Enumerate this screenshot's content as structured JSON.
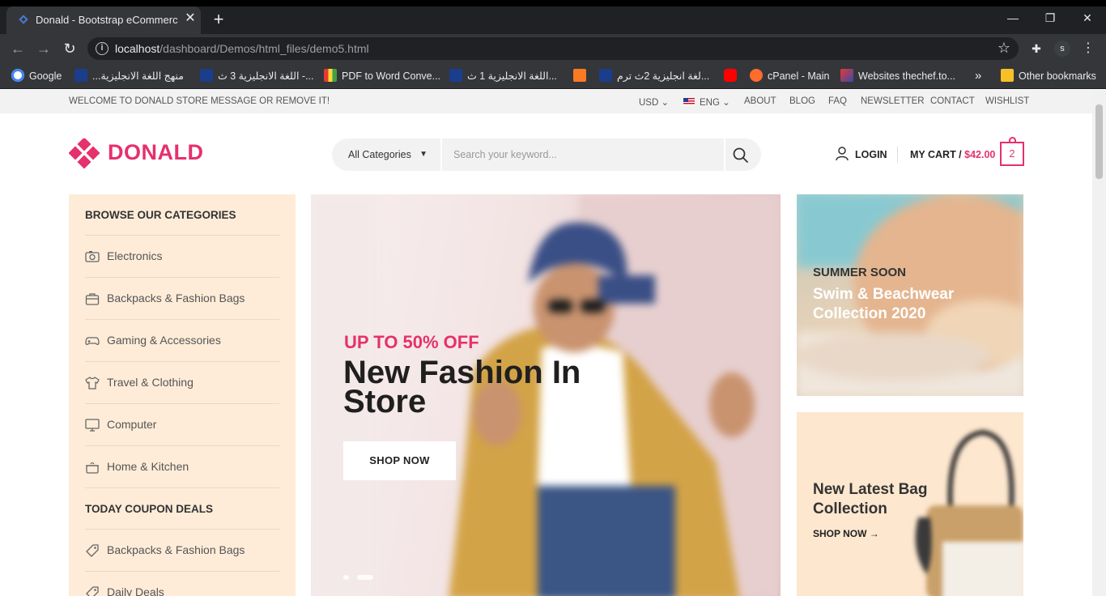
{
  "browser": {
    "tab_title": "Donald - Bootstrap eCommerce T",
    "tab_close": "✕",
    "new_tab": "+",
    "window_controls": [
      "—",
      "❐",
      "✕"
    ],
    "url_host": "localhost",
    "url_path": "/dashboard/Demos/html_files/demo5.html",
    "profile_initial": "s",
    "bookmarks": [
      {
        "label": "Google",
        "icon": "google-icon",
        "color": "#4285f4"
      },
      {
        "label": "...منهج اللغة الانجليزية",
        "icon": "site-icon",
        "color": "#1a3e8c"
      },
      {
        "label": "اللغة الانجليزية 3 ث -...",
        "icon": "site-icon",
        "color": "#1a3e8c"
      },
      {
        "label": "PDF to Word Conve...",
        "icon": "pdf-icon",
        "color": "#7b3fe4"
      },
      {
        "label": "اللغة الانجليزية 1 ث...",
        "icon": "site-icon",
        "color": "#1a3e8c"
      },
      {
        "label": "",
        "icon": "xampp-icon",
        "color": "#fb7a24"
      },
      {
        "label": "لغة انجليزية 2ث ترم...",
        "icon": "site-icon",
        "color": "#1a3e8c"
      },
      {
        "label": "",
        "icon": "youtube-icon",
        "color": "#ff0000"
      },
      {
        "label": "cPanel - Main",
        "icon": "cpanel-icon",
        "color": "#ff6c2c"
      },
      {
        "label": "Websites thechef.to...",
        "icon": "site-icon",
        "color": "#7b1fa2"
      }
    ],
    "bookmarks_more": "»",
    "other_bookmarks": "Other bookmarks"
  },
  "topbar": {
    "welcome": "WELCOME TO DONALD STORE MESSAGE OR REMOVE IT!",
    "currency": "USD",
    "language": "ENG",
    "links": [
      "ABOUT",
      "BLOG",
      "FAQ",
      "NEWSLETTER",
      "CONTACT",
      "WISHLIST"
    ]
  },
  "header": {
    "brand": "DONALD",
    "brand_color": "#e5316c",
    "category_select": "All Categories",
    "search_placeholder": "Search your keyword...",
    "login": "LOGIN",
    "cart_label": "MY CART /",
    "cart_total": "$42.00",
    "cart_count": "2"
  },
  "sidebar": {
    "browse_heading": "BROWSE OUR CATEGORIES",
    "categories": [
      {
        "label": "Electronics",
        "icon": "camera-icon"
      },
      {
        "label": "Backpacks & Fashion Bags",
        "icon": "bag-icon"
      },
      {
        "label": "Gaming & Accessories",
        "icon": "gamepad-icon"
      },
      {
        "label": "Travel & Clothing",
        "icon": "shirt-icon"
      },
      {
        "label": "Computer",
        "icon": "monitor-icon"
      },
      {
        "label": "Home & Kitchen",
        "icon": "pot-icon"
      }
    ],
    "deals_heading": "TODAY COUPON DEALS",
    "deals": [
      {
        "label": "Backpacks & Fashion Bags",
        "icon": "tag-icon"
      },
      {
        "label": "Daily Deals",
        "icon": "tag-icon"
      }
    ]
  },
  "hero": {
    "promo": "UP TO 50% OFF",
    "headline": "New Fashion In Store",
    "cta": "SHOP NOW",
    "slide_count": 2,
    "active_slide": 2
  },
  "banners": [
    {
      "kicker": "SUMMER SOON",
      "title": "Swim & Beachwear Collection 2020"
    },
    {
      "title": "New Latest Bag Collection",
      "link": "SHOP NOW →"
    }
  ]
}
